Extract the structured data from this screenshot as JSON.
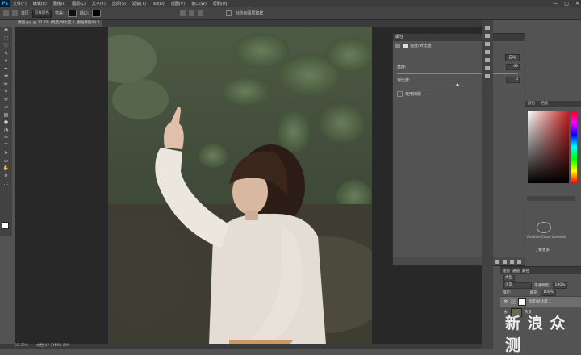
{
  "menu": {
    "logo": "Ps",
    "items": [
      "文件(F)",
      "编辑(E)",
      "图像(I)",
      "图层(L)",
      "文字(Y)",
      "选择(S)",
      "滤镜(T)",
      "3D(D)",
      "视图(V)",
      "窗口(W)",
      "帮助(H)"
    ],
    "window_controls": [
      "—",
      "□",
      "✕"
    ]
  },
  "options": {
    "mode_label": "选区",
    "mode_value": "取样颜色",
    "tolerance_label": "容差:",
    "sample_label": "描边:",
    "contiguous_label": "对所有图层取样"
  },
  "document": {
    "tab_title": "原图.jpg @ 22.7% (亮度/对比度 1, 图层蒙版/8) *",
    "zoom": "22.72%",
    "doc_info": "文档:47.7M/85.5M"
  },
  "tools": [
    "move-icon",
    "marquee-icon",
    "lasso-icon",
    "quick-select-icon",
    "crop-icon",
    "eyedropper-icon",
    "healing-icon",
    "brush-icon",
    "stamp-icon",
    "history-brush-icon",
    "eraser-icon",
    "gradient-icon",
    "blur-icon",
    "dodge-icon",
    "pen-icon",
    "type-icon",
    "path-select-icon",
    "rectangle-icon",
    "hand-icon",
    "zoom-icon",
    "more-icon"
  ],
  "properties": {
    "header": "属性",
    "title": "亮度/对比度",
    "auto_button": "自动",
    "brightness_label": "亮度:",
    "brightness_value": "69",
    "brightness_fraction": 0.73,
    "contrast_label": "对比度:",
    "contrast_value": "0",
    "contrast_fraction": 0.5,
    "legacy_label": "使用旧版"
  },
  "right_panel": {
    "tab1": "颜色",
    "tab2": "色板",
    "cc_text_1": "图层",
    "cc_text_2": "选区",
    "cc_libraries": "Creative Cloud Libraries",
    "learn_more": "了解更多"
  },
  "layers": {
    "tab1": "图层",
    "tab2": "通道",
    "tab3": "路径",
    "kind": "类型",
    "blend": "正常",
    "opacity_label": "不透明度:",
    "opacity": "100%",
    "fill_label": "填充:",
    "fill": "100%",
    "lock_label": "锁定:",
    "items": [
      {
        "name": "亮度/对比度 1",
        "selected": true
      },
      {
        "name": "背景",
        "selected": false
      }
    ]
  },
  "watermark": "新 浪 众 测",
  "colors": {
    "app_bg": "#535353",
    "menu_bg": "#3c3c3c",
    "accent": "#31a8ff"
  }
}
